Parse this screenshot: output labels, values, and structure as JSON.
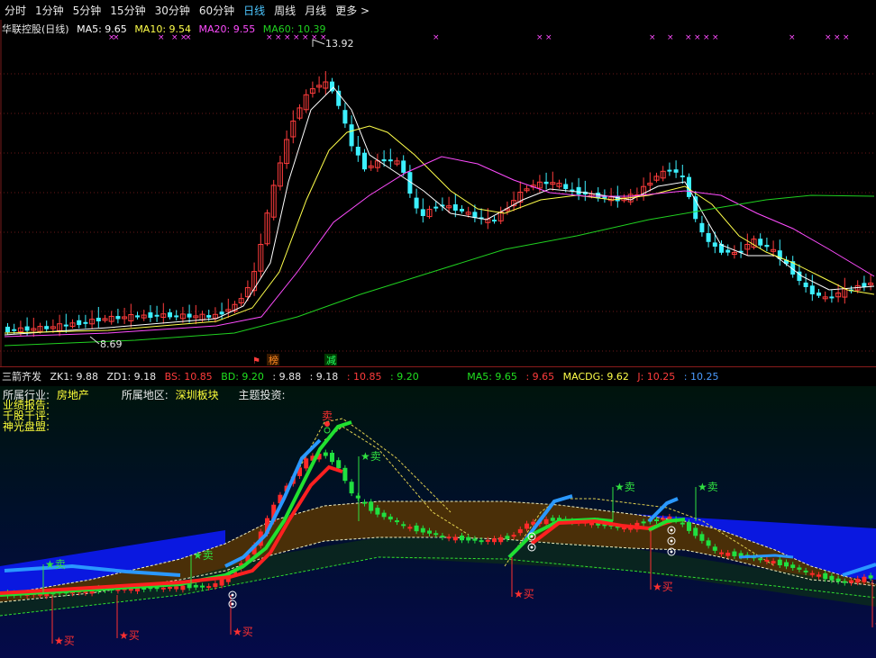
{
  "tabs": [
    "分时",
    "1分钟",
    "5分钟",
    "15分钟",
    "30分钟",
    "60分钟",
    "日线",
    "周线",
    "月线",
    "更多 >"
  ],
  "active_tab": "日线",
  "main_legend": {
    "title": "华联控股(日线)",
    "ma5": "MA5: 9.65",
    "ma10": "MA10: 9.54",
    "ma20": "MA20: 9.55",
    "ma60": "MA60: 10.39"
  },
  "price_annotations": {
    "high": "13.92",
    "low": "8.69"
  },
  "event_tags": [
    "榜",
    "减"
  ],
  "indicator_legend": {
    "name": "三箭齐发",
    "zk1": "ZK1: 9.88",
    "zd1": "ZD1: 9.18",
    "bs": "BS: 10.85",
    "bd": "BD: 9.20",
    "v1": ": 9.88",
    "v2": ": 9.18",
    "v3": ": 10.85",
    "v4": ": 9.20",
    "ma5": "MA5: 9.65",
    "v5": ": 9.65",
    "macdg": "MACDG: 9.62",
    "j": "J: 10.25",
    "v6": ": 10.25"
  },
  "info": {
    "industry_label": "所属行业:",
    "industry": "房地产",
    "region_label": "所属地区:",
    "region": "深圳板块",
    "theme_label": "主题投资:",
    "notes": [
      "业绩报告:",
      "千股千评:",
      "神光盘盟:"
    ]
  },
  "signals": {
    "buy": "买",
    "sell": "卖",
    "buy_star": "★买",
    "sell_star": "★卖"
  },
  "colors": {
    "up": "#ff3c3c",
    "down": "#3cf0ff",
    "ma5": "#ffffff",
    "ma10": "#ffff4a",
    "ma20": "#ff4cff",
    "ma60": "#20d020",
    "accent": "#4cc6ff"
  },
  "chart_data": {
    "type": "candlestick",
    "title": "华联控股(日线)",
    "high_label": 13.92,
    "low_label": 8.69,
    "series": [
      {
        "name": "MA5",
        "last": 9.65
      },
      {
        "name": "MA10",
        "last": 9.54
      },
      {
        "name": "MA20",
        "last": 9.55
      },
      {
        "name": "MA60",
        "last": 10.39
      }
    ]
  }
}
